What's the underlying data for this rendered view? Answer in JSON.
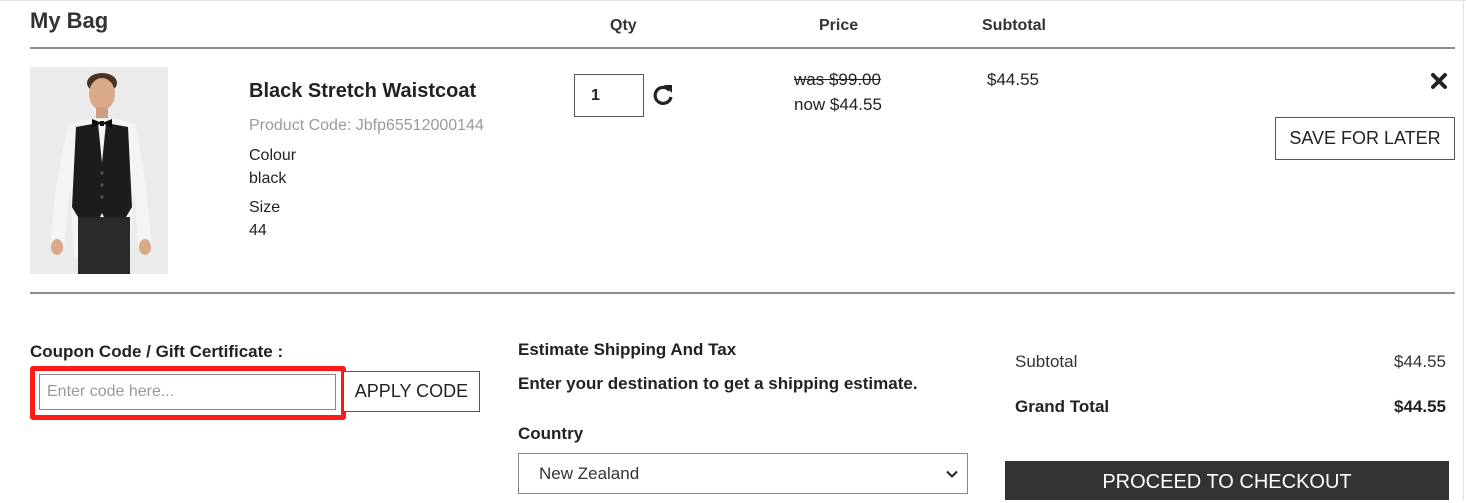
{
  "header": {
    "title": "My Bag",
    "col_qty": "Qty",
    "col_price": "Price",
    "col_subtotal": "Subtotal"
  },
  "item": {
    "name": "Black Stretch Waistcoat",
    "product_code": "Product Code: Jbfp65512000144",
    "colour_label": "Colour",
    "colour_value": "black",
    "size_label": "Size",
    "size_value": "44",
    "qty": "1",
    "price_was": "was $99.00",
    "price_now": "now $44.55",
    "subtotal": "$44.55",
    "save_for_later_label": "SAVE FOR LATER",
    "remove_icon": "close-icon",
    "refresh_icon": "refresh-icon"
  },
  "coupon": {
    "label": "Coupon Code / Gift Certificate :",
    "placeholder": "Enter code here...",
    "value": "",
    "apply_label": "APPLY CODE",
    "highlight_color": "#ff1a1a"
  },
  "shipping": {
    "title": "Estimate Shipping And Tax",
    "subtitle": "Enter your destination to get a shipping estimate.",
    "country_label": "Country",
    "country_value": "New Zealand"
  },
  "summary": {
    "subtotal_label": "Subtotal",
    "subtotal_value": "$44.55",
    "grand_total_label": "Grand Total",
    "grand_total_value": "$44.55",
    "checkout_label": "PROCEED TO CHECKOUT"
  },
  "colors": {
    "divider": "#8c8c8c",
    "checkout_bg": "#333333",
    "muted_text": "#9a9a9a"
  }
}
